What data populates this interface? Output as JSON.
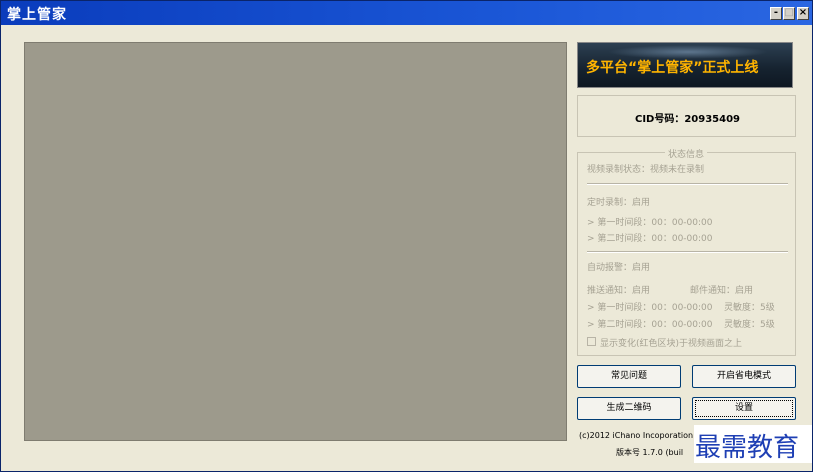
{
  "window": {
    "title": "掌上管家",
    "minimize_label": "-",
    "maximize_label": "□",
    "close_label": "×"
  },
  "banner": {
    "text": "多平台“掌上管家”正式上线"
  },
  "cid": {
    "text": "CID号码：20935409"
  },
  "status": {
    "legend": "状态信息",
    "record_status": "视频录制状态：视频未在录制",
    "timer_record": "定时录制：启用",
    "timer_period1": "> 第一时间段：00：00-00:00",
    "timer_period2": "> 第二时间段：00：00-00:00",
    "auto_alarm": "自动报警：启用",
    "push_notify": "推送通知：启用",
    "mail_notify": "邮件通知：启用",
    "alarm_period1": "> 第一时间段：00：00-00:00",
    "alarm_sensitivity1": "灵敏度：5级",
    "alarm_period2": "> 第二时间段：00：00-00:00",
    "alarm_sensitivity2": "灵敏度：5级",
    "show_change_label": "显示变化(红色区块)于视频画面之上"
  },
  "buttons": {
    "faq": "常见问题",
    "power_saving": "开启省电模式",
    "qr_code": "生成二维码",
    "settings": "设置"
  },
  "footer": {
    "copyright": "(c)2012 iChano Incoporation",
    "version": "版本号 1.7.0  (buil"
  },
  "watermark": {
    "text": "最需教育"
  }
}
